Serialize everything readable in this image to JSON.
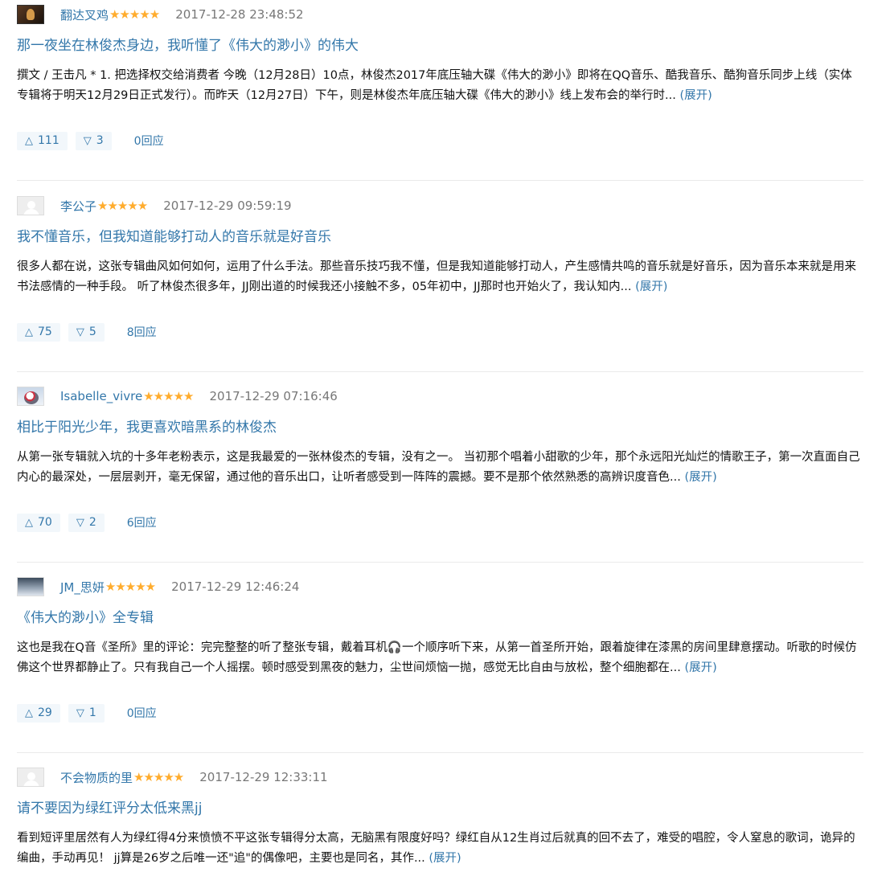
{
  "reviews": [
    {
      "author": "翻达叉鸡",
      "stars": "★★★★★",
      "time": "2017-12-28 23:48:52",
      "title": "那一夜坐在林俊杰身边，我听懂了《伟大的渺小》的伟大",
      "body": "撰文 / 王击凡 * 1. 把选择权交给消费者 今晚（12月28日）10点，林俊杰2017年底压轴大碟《伟大的渺小》即将在QQ音乐、酷我音乐、酷狗音乐同步上线（实体专辑将于明天12月29日正式发行）。而昨天（12月27日）下午，则是林俊杰年底压轴大碟《伟大的渺小》线上发布会的举行时... ",
      "expand": "(展开)",
      "up": "111",
      "down": "3",
      "replies": "0回应"
    },
    {
      "author": "李公子",
      "stars": "★★★★★",
      "time": "2017-12-29 09:59:19",
      "title": "我不懂音乐，但我知道能够打动人的音乐就是好音乐",
      "body": "很多人都在说，这张专辑曲风如何如何，运用了什么手法。那些音乐技巧我不懂，但是我知道能够打动人，产生感情共鸣的音乐就是好音乐，因为音乐本来就是用来书法感情的一种手段。 听了林俊杰很多年，JJ刚出道的时候我还小接触不多，05年初中，JJ那时也开始火了，我认知内... ",
      "expand": "(展开)",
      "up": "75",
      "down": "5",
      "replies": "8回应"
    },
    {
      "author": "Isabelle_vivre",
      "stars": "★★★★★",
      "time": "2017-12-29 07:16:46",
      "title": "相比于阳光少年，我更喜欢暗黑系的林俊杰",
      "body": "从第一张专辑就入坑的十多年老粉表示，这是我最爱的一张林俊杰的专辑，没有之一。 当初那个唱着小甜歌的少年，那个永远阳光灿烂的情歌王子，第一次直面自己内心的最深处，一层层剥开，毫无保留，通过他的音乐出口，让听者感受到一阵阵的震撼。要不是那个依然熟悉的高辨识度音色... ",
      "expand": "(展开)",
      "up": "70",
      "down": "2",
      "replies": "6回应"
    },
    {
      "author": "JM_思妍",
      "stars": "★★★★★",
      "time": "2017-12-29 12:46:24",
      "title": "《伟大的渺小》全专辑",
      "body": "这也是我在Q音《圣所》里的评论：完完整整的听了整张专辑，戴着耳机🎧一个顺序听下来，从第一首圣所开始，跟着旋律在漆黑的房间里肆意摆动。听歌的时候仿佛这个世界都静止了。只有我自己一个人摇摆。顿时感受到黑夜的魅力，尘世间烦恼一抛，感觉无比自由与放松，整个细胞都在... ",
      "expand": "(展开)",
      "up": "29",
      "down": "1",
      "replies": "0回应"
    },
    {
      "author": "不会物质的里",
      "stars": "★★★★★",
      "time": "2017-12-29 12:33:11",
      "title": "请不要因为绿红评分太低来黑jj",
      "body": "看到短评里居然有人为绿红得4分来愤愤不平这张专辑得分太高，无脑黑有限度好吗？绿红自从12生肖过后就真的回不去了，难受的唱腔，令人窒息的歌词，诡异的编曲，手动再见！ jj算是26岁之后唯一还\"追\"的偶像吧，主要也是同名，其作... ",
      "expand": "(展开)",
      "up": "",
      "down": "",
      "replies": ""
    }
  ],
  "icons": {
    "up": "triangle-up-outline",
    "down": "triangle-down-outline",
    "rating": "star-filled"
  },
  "colors": {
    "link": "#3377aa",
    "star": "#ffac2d",
    "vote_bg": "#f2f7fb",
    "divider": "#eaeaea"
  }
}
